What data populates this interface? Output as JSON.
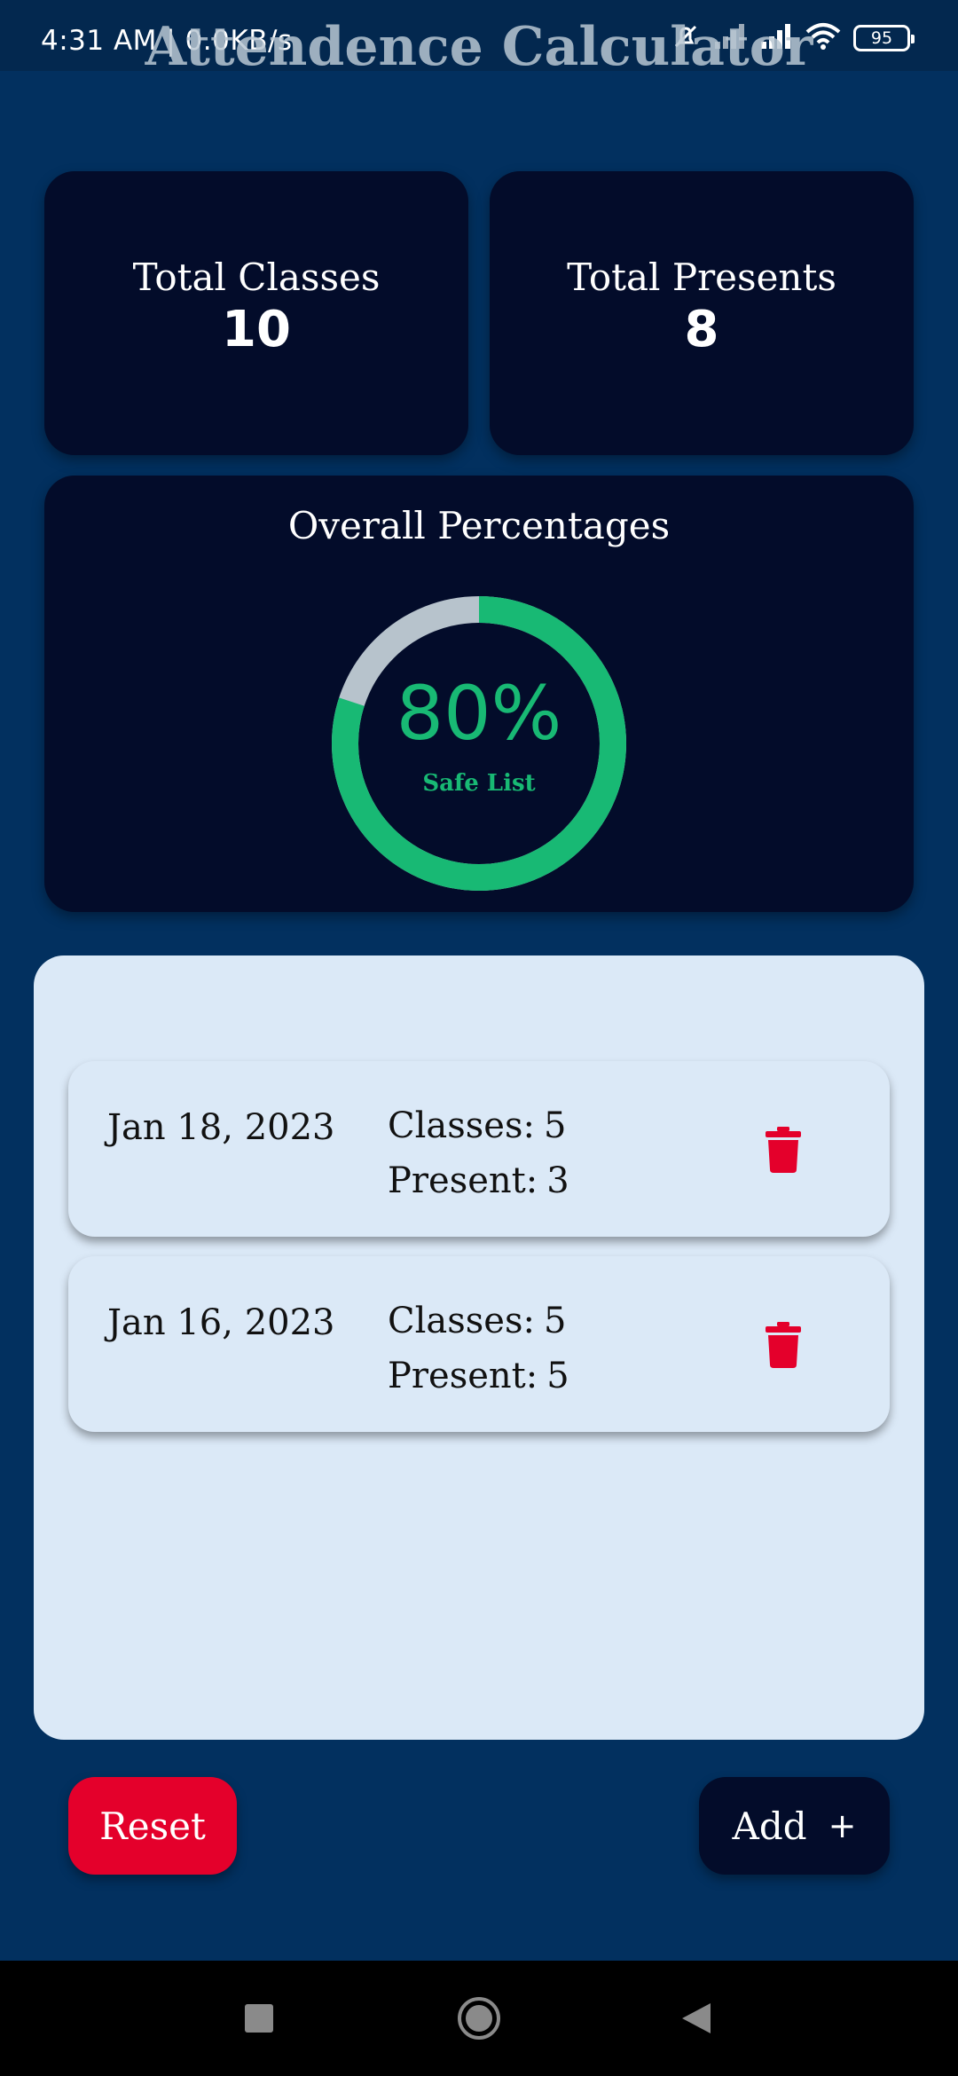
{
  "status_bar": {
    "time_network": "4:31 AM | 0.0KB/s",
    "battery": "95"
  },
  "app": {
    "title": "Attendence Calculator"
  },
  "stats": {
    "total_classes_label": "Total Classes",
    "total_classes_value": "10",
    "total_presents_label": "Total Presents",
    "total_presents_value": "8"
  },
  "overall": {
    "title": "Overall Percentages",
    "percent_text": "80%",
    "percent_value": 0.8,
    "status": "Safe List",
    "colors": {
      "progress": "#18b974",
      "track": "#b7c3cc"
    }
  },
  "entries": [
    {
      "date": "Jan 18, 2023",
      "classes_label": "Classes:",
      "classes": "5",
      "present_label": "Present:",
      "present": "3",
      "action_icon": "trash-icon"
    },
    {
      "date": "Jan 16, 2023",
      "classes_label": "Classes:",
      "classes": "5",
      "present_label": "Present:",
      "present": "5",
      "action_icon": "trash-icon"
    }
  ],
  "actions": {
    "reset_label": "Reset",
    "add_label": "Add",
    "add_icon": "+"
  },
  "colors": {
    "background": "#02305f",
    "card": "#030c2a",
    "panel": "#dbe9f7",
    "danger": "#e4002b"
  }
}
